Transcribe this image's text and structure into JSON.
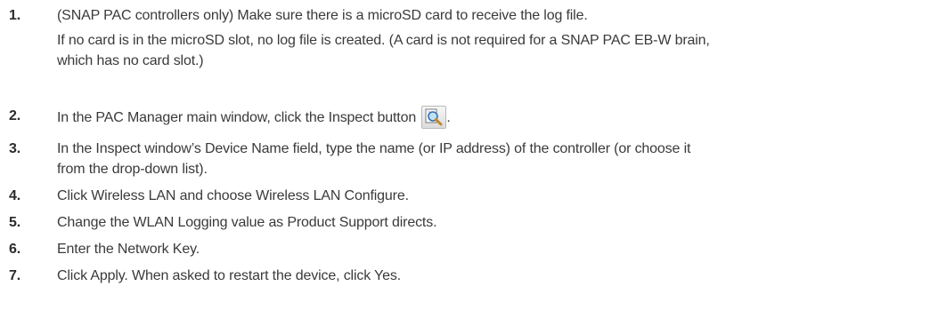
{
  "steps": [
    {
      "number": "1.",
      "text": "(SNAP PAC controllers only) Make sure there is a microSD card to receive the log file.",
      "note_line1": "If no card is in the microSD slot, no log file is created. (A card is not required for a SNAP PAC EB-W brain,",
      "note_line2": "which has no card slot.)"
    },
    {
      "number": "2.",
      "text": "In the PAC Manager main window, click the Inspect button",
      "after_icon": ".",
      "icon": "inspect-magnifier-icon"
    },
    {
      "number": "3.",
      "line1": "In the Inspect window’s Device Name field, type the name (or IP address) of the controller (or choose it",
      "line2": "from the drop-down list)."
    },
    {
      "number": "4.",
      "text": "Click Wireless LAN and choose Wireless LAN Configure."
    },
    {
      "number": "5.",
      "text": "Change the WLAN Logging value as Product Support directs."
    },
    {
      "number": "6.",
      "text": "Enter the Network Key."
    },
    {
      "number": "7.",
      "text": "Click Apply. When asked to restart the device, click Yes."
    }
  ]
}
